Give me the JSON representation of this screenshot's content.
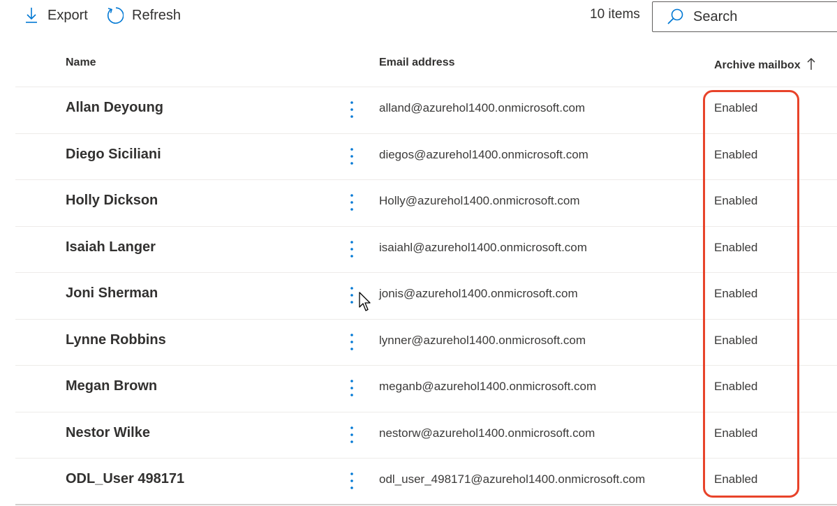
{
  "toolbar": {
    "export_label": "Export",
    "refresh_label": "Refresh",
    "items_count": "10 items",
    "search_placeholder": "Search"
  },
  "columns": {
    "name": "Name",
    "email": "Email address",
    "archive": "Archive mailbox",
    "archive_sort": "ascending"
  },
  "rows": [
    {
      "name": "Allan Deyoung",
      "email": "alland@azurehol1400.onmicrosoft.com",
      "archive": "Enabled"
    },
    {
      "name": "Diego Siciliani",
      "email": "diegos@azurehol1400.onmicrosoft.com",
      "archive": "Enabled"
    },
    {
      "name": "Holly Dickson",
      "email": "Holly@azurehol1400.onmicrosoft.com",
      "archive": "Enabled"
    },
    {
      "name": "Isaiah Langer",
      "email": "isaiahl@azurehol1400.onmicrosoft.com",
      "archive": "Enabled"
    },
    {
      "name": "Joni Sherman",
      "email": "jonis@azurehol1400.onmicrosoft.com",
      "archive": "Enabled"
    },
    {
      "name": "Lynne Robbins",
      "email": "lynner@azurehol1400.onmicrosoft.com",
      "archive": "Enabled"
    },
    {
      "name": "Megan Brown",
      "email": "meganb@azurehol1400.onmicrosoft.com",
      "archive": "Enabled"
    },
    {
      "name": "Nestor Wilke",
      "email": "nestorw@azurehol1400.onmicrosoft.com",
      "archive": "Enabled"
    },
    {
      "name": "ODL_User 498171",
      "email": "odl_user_498171@azurehol1400.onmicrosoft.com",
      "archive": "Enabled"
    }
  ],
  "colors": {
    "accent": "#0078d4",
    "highlight": "#e8432a",
    "text": "#323130"
  },
  "icons": {
    "export": "download-arrow-icon",
    "refresh": "refresh-icon",
    "search": "search-icon",
    "more": "more-vertical-icon",
    "sort": "sort-ascending-icon"
  }
}
